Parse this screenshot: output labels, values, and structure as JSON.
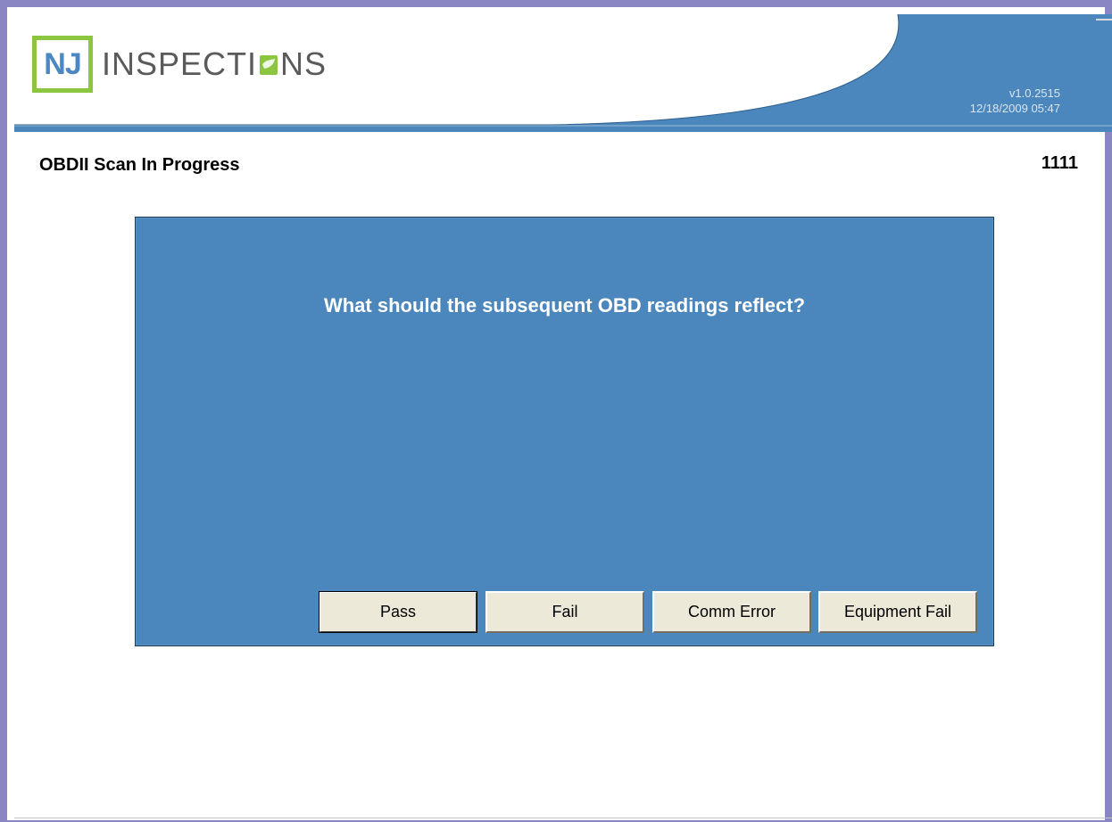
{
  "header": {
    "logo_mark": "NJ",
    "logo_word_pre": "INSPECTI",
    "logo_word_post": "NS",
    "version": "v1.0.2515",
    "datetime": "12/18/2009 05:47"
  },
  "page": {
    "title": "OBDII Scan In Progress",
    "station_id": "1111"
  },
  "dialog": {
    "question": "What should the subsequent OBD readings reflect?",
    "buttons": {
      "pass": "Pass",
      "fail": "Fail",
      "comm_error": "Comm Error",
      "equipment_fail": "Equipment Fail"
    }
  },
  "colors": {
    "frame_border": "#8a86c4",
    "header_blue": "#4b86bc",
    "dialog_blue": "#4b86bc",
    "logo_green": "#8cc63f",
    "logo_blue": "#4b87c2",
    "button_face": "#ece9d8"
  }
}
